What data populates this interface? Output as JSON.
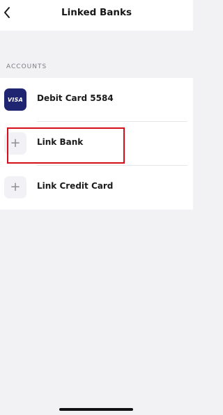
{
  "header": {
    "title": "Linked Banks",
    "back_icon": "chevron-left-icon"
  },
  "section": {
    "label": "ACCOUNTS"
  },
  "accounts": [
    {
      "label": "Debit Card 5584",
      "icon": "visa-card-icon",
      "icon_text": "VISA"
    },
    {
      "label": "Link Bank",
      "icon": "plus-icon"
    },
    {
      "label": "Link Credit Card",
      "icon": "plus-icon"
    }
  ],
  "colors": {
    "background": "#f2f1f4",
    "card": "#ffffff",
    "visa": "#1f2570",
    "highlight": "#d50f1a",
    "plus": "#8e8e93"
  }
}
